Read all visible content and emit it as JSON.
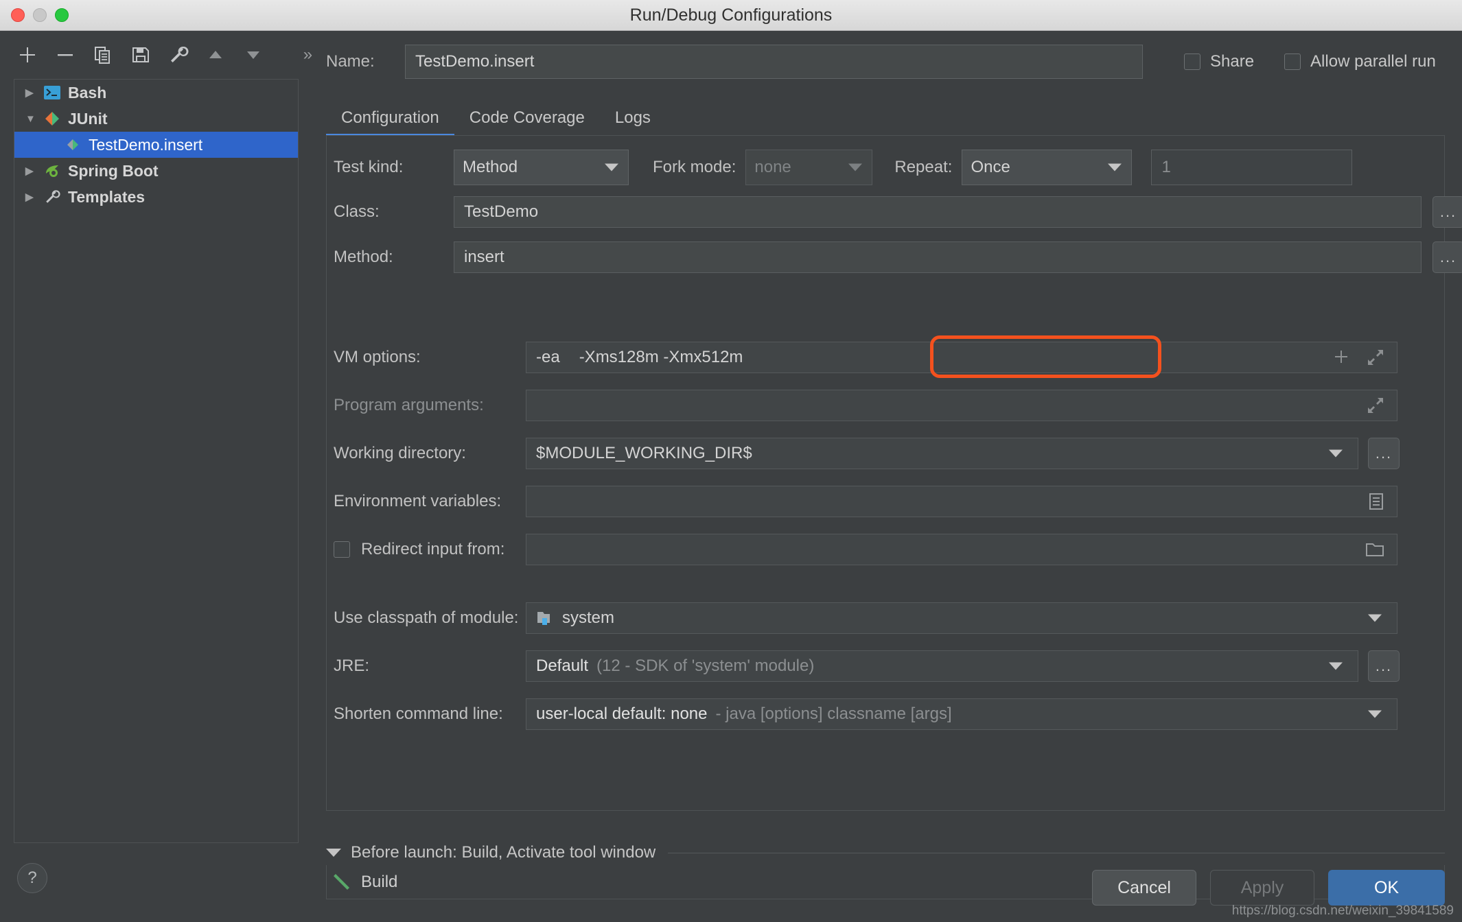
{
  "window": {
    "title": "Run/Debug Configurations",
    "traffic_lights": [
      "close-red",
      "minimize-grey",
      "maximize-green"
    ]
  },
  "sidebar": {
    "toolbar": [
      {
        "name": "add-configuration-button",
        "icon": "plus-icon"
      },
      {
        "name": "remove-configuration-button",
        "icon": "minus-icon"
      },
      {
        "name": "copy-configuration-button",
        "icon": "copy-icon"
      },
      {
        "name": "save-configuration-button",
        "icon": "save-icon"
      },
      {
        "name": "edit-templates-button",
        "icon": "wrench-icon"
      },
      {
        "name": "move-up-button",
        "icon": "arrow-up-icon"
      },
      {
        "name": "move-down-button",
        "icon": "arrow-down-icon"
      },
      {
        "name": "more-options-button",
        "icon": "chevron-right-double-icon"
      }
    ],
    "tree": [
      {
        "label": "Bash",
        "icon": "bash-terminal-icon",
        "expanded": false,
        "selected": false,
        "level": 0
      },
      {
        "label": "JUnit",
        "icon": "junit-icon",
        "expanded": true,
        "selected": false,
        "level": 0
      },
      {
        "label": "TestDemo.insert",
        "icon": "junit-icon",
        "expanded": null,
        "selected": true,
        "level": 1
      },
      {
        "label": "Spring Boot",
        "icon": "spring-boot-icon",
        "expanded": false,
        "selected": false,
        "level": 0
      },
      {
        "label": "Templates",
        "icon": "wrench-icon",
        "expanded": false,
        "selected": false,
        "level": 0
      }
    ],
    "help_label": "?"
  },
  "header": {
    "name_label": "Name:",
    "name_value": "TestDemo.insert",
    "share_label": "Share",
    "share_checked": false,
    "allow_parallel_label": "Allow parallel run",
    "allow_parallel_checked": false
  },
  "tabs": [
    {
      "label": "Configuration",
      "active": true
    },
    {
      "label": "Code Coverage",
      "active": false
    },
    {
      "label": "Logs",
      "active": false
    }
  ],
  "form": {
    "test_kind_label": "Test kind:",
    "test_kind_value": "Method",
    "fork_mode_label": "Fork mode:",
    "fork_mode_value": "none",
    "repeat_label": "Repeat:",
    "repeat_value": "Once",
    "repeat_count_value": "1",
    "class_label": "Class:",
    "class_value": "TestDemo",
    "method_label": "Method:",
    "method_value": "insert",
    "vm_options_label": "VM options:",
    "vm_options_prefix": "-ea",
    "vm_options_highlighted": "-Xms128m  -Xmx512m",
    "program_arguments_label": "Program arguments:",
    "program_arguments_value": "",
    "working_directory_label": "Working directory:",
    "working_directory_value": "$MODULE_WORKING_DIR$",
    "environment_variables_label": "Environment variables:",
    "environment_variables_value": "",
    "redirect_input_label": "Redirect input from:",
    "redirect_input_checked": false,
    "redirect_input_value": "",
    "classpath_label": "Use classpath of module:",
    "classpath_value": "system",
    "jre_label": "JRE:",
    "jre_value_strong": "Default",
    "jre_value_dim": "(12 - SDK of 'system' module)",
    "shorten_label": "Shorten command line:",
    "shorten_value_strong": "user-local default: none",
    "shorten_value_dim": "- java [options] classname [args]",
    "browse_label": "..."
  },
  "before_launch": {
    "header": "Before launch: Build, Activate tool window",
    "items": [
      {
        "label": "Build",
        "icon": "build-hammer-icon"
      }
    ]
  },
  "footer": {
    "cancel_label": "Cancel",
    "apply_label": "Apply",
    "apply_enabled": false,
    "ok_label": "OK",
    "watermark": "https://blog.csdn.net/weixin_39841589"
  },
  "colors": {
    "background": "#3c3f41",
    "selection_blue": "#2f65ca",
    "accent_blue": "#4a88df",
    "ok_button": "#3b6ea8",
    "annotation_red": "#f4511e",
    "title_bar": "#e0e0e0"
  }
}
